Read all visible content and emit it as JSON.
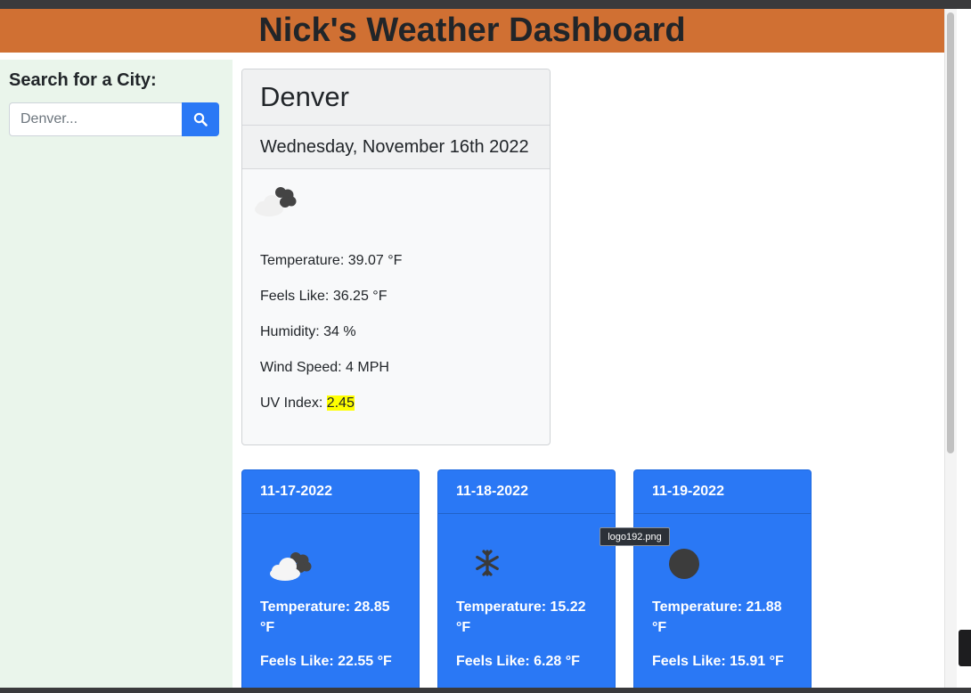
{
  "header": {
    "title": "Nick's Weather Dashboard"
  },
  "sidebar": {
    "heading": "Search for a City:",
    "search": {
      "placeholder": "Denver...",
      "value": ""
    },
    "search_icon": "search-icon"
  },
  "current": {
    "city": "Denver",
    "date": "Wednesday, November 16th 2022",
    "icon": "cloud-icon",
    "temperature": "Temperature: 39.07 °F",
    "feels_like": "Feels Like: 36.25 °F",
    "humidity": "Humidity: 34 %",
    "wind_speed": "Wind Speed: 4 MPH",
    "uv_label": "UV Index: ",
    "uv_value": "2.45",
    "uv_color": "#ffff00"
  },
  "forecast": [
    {
      "date": "11-17-2022",
      "icon": "cloud-icon",
      "temperature": "Temperature: 28.85 °F",
      "feels_like": "Feels Like: 22.55 °F"
    },
    {
      "date": "11-18-2022",
      "icon": "snowflake-icon",
      "temperature": "Temperature: 15.22 °F",
      "feels_like": "Feels Like: 6.28 °F"
    },
    {
      "date": "11-19-2022",
      "icon": "circle-icon",
      "temperature": "Temperature: 21.88 °F",
      "feels_like": "Feels Like: 15.91 °F"
    }
  ],
  "tooltip": {
    "text": "logo192.png"
  },
  "colors": {
    "header_bg": "#d07033",
    "sidebar_bg": "#eaf5eb",
    "forecast_bg": "#2a78f5",
    "search_button": "#2a78f5"
  }
}
